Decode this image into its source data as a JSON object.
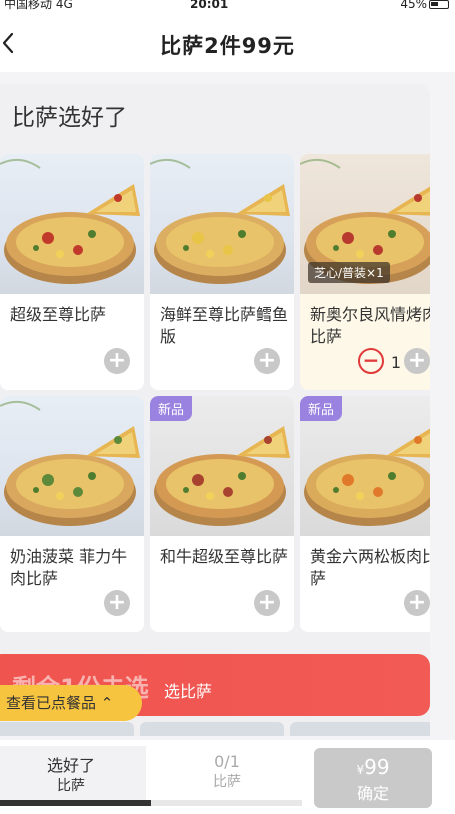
{
  "status_bar": {
    "carrier": "中国移动 4G",
    "time": "20:01",
    "battery": "45%"
  },
  "nav": {
    "title": "比萨2件99元",
    "back_icon": "chevron-left-icon"
  },
  "section": {
    "title": "比萨选好了"
  },
  "products": [
    {
      "name": "超级至尊比萨",
      "tag": "",
      "new": "",
      "selected": false,
      "qty": ""
    },
    {
      "name": "海鲜至尊比萨鳕鱼版",
      "tag": "",
      "new": "",
      "selected": false,
      "qty": ""
    },
    {
      "name": "新奥尔良风情烤肉比萨",
      "tag": "芝心/普装×1",
      "new": "",
      "selected": true,
      "qty": "1"
    },
    {
      "name": "奶油菠菜 菲力牛肉比萨",
      "tag": "",
      "new": "",
      "selected": false,
      "qty": ""
    },
    {
      "name": "和牛超级至尊比萨",
      "tag": "",
      "new": "新品",
      "selected": false,
      "qty": ""
    },
    {
      "name": "黄金六两松板肉比萨",
      "tag": "",
      "new": "新品",
      "selected": false,
      "qty": ""
    }
  ],
  "remaining": {
    "title": "剩余1份未选",
    "subtitle": "选比萨"
  },
  "ordered_pill": {
    "label": "查看已点餐品 ⌃"
  },
  "bottom": {
    "step1": {
      "title": "选好了",
      "sub": "比萨"
    },
    "step2": {
      "title": "0/1",
      "sub": "比萨"
    },
    "progress_fraction": 0.5,
    "confirm": {
      "currency": "¥",
      "price": "99",
      "label": "确定"
    }
  },
  "colors": {
    "accent_red": "#f0544f",
    "pill_yellow": "#f7c440",
    "new_badge": "#9a82e0",
    "disabled": "#c9c9c9"
  }
}
